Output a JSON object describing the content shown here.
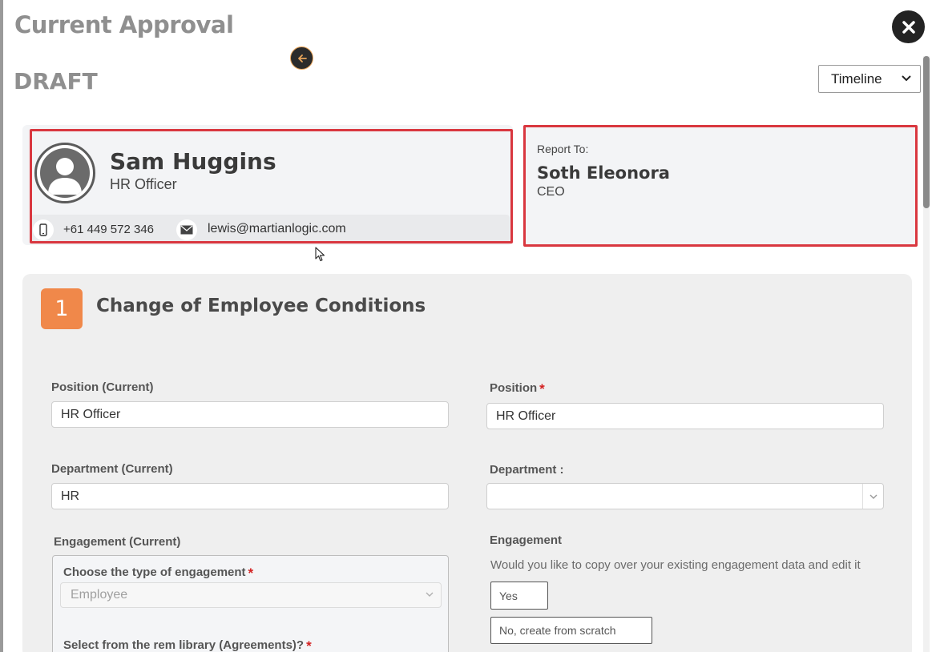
{
  "header": {
    "title": "Current Approval",
    "status": "DRAFT",
    "view_select": "Timeline"
  },
  "employee": {
    "name": "Sam Huggins",
    "role": "HR Officer",
    "phone": "+61 449 572 346",
    "email": "lewis@martianlogic.com"
  },
  "report_to": {
    "label": "Report To:",
    "name": "Soth Eleonora",
    "role": "CEO"
  },
  "section": {
    "number": "1",
    "title": "Change of Employee Conditions"
  },
  "form": {
    "position_current_label": "Position (Current)",
    "position_current_value": "HR Officer",
    "position_label": "Position",
    "position_value": "HR Officer",
    "department_current_label": "Department (Current)",
    "department_current_value": "HR",
    "department_label": "Department :",
    "department_value": "",
    "engagement_current_label": "Engagement (Current)",
    "engagement_type_label": "Choose the type of engagement",
    "engagement_type_value": "Employee",
    "rem_library_label": "Select from the rem library (Agreements)?",
    "engagement_label": "Engagement",
    "engagement_question": "Would you like to copy over your existing engagement data and edit it",
    "option_yes": "Yes",
    "option_no": "No, create from scratch",
    "required_mark": "*"
  },
  "colors": {
    "highlight_red": "#d9373f",
    "step_orange": "#f0884a",
    "required_red": "#d32020"
  },
  "icons": {
    "close": "close-icon",
    "back": "arrow-left-icon",
    "dropdown": "chevron-down-icon",
    "avatar": "user-avatar-icon",
    "phone": "phone-icon",
    "email": "envelope-icon"
  }
}
